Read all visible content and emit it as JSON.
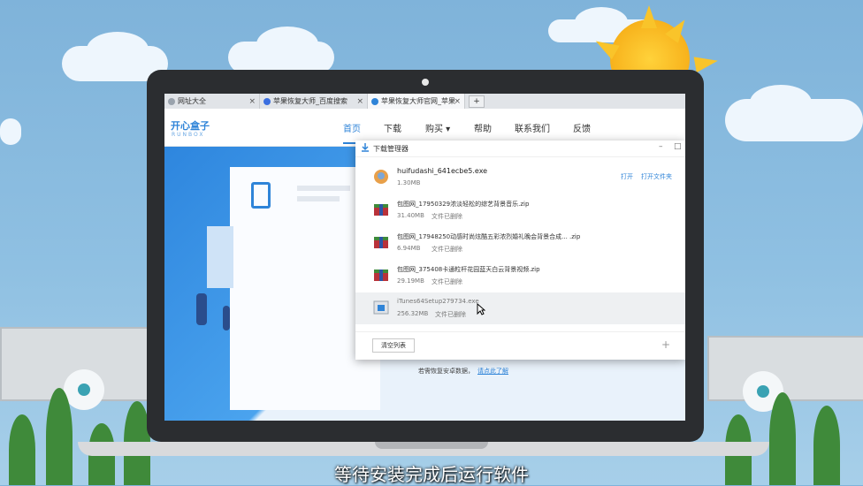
{
  "browser": {
    "tabs": [
      {
        "label": "网址大全"
      },
      {
        "label": "苹果恢复大师_百度搜索"
      },
      {
        "label": "苹果恢复大师官网_苹果"
      }
    ],
    "new_tab_label": "+",
    "close_glyph": "×"
  },
  "site": {
    "logo": "开心盒子",
    "logo_sub": "RUNBOX",
    "nav": [
      {
        "label": "首页"
      },
      {
        "label": "下载"
      },
      {
        "label": "购买 ▾"
      },
      {
        "label": "帮助"
      },
      {
        "label": "联系我们"
      },
      {
        "label": "反馈"
      }
    ],
    "footer_line1": "若需恢复安卓数据，",
    "footer_link": "请点此了解"
  },
  "download_manager": {
    "title": "下载管理器",
    "minimize": "–",
    "maximize": "□",
    "items": [
      {
        "name": "huifudashi_641ecbe5.exe",
        "size": "1.30MB",
        "status": "",
        "actions": [
          "打开",
          "打开文件夹"
        ],
        "icon": "app-icon"
      },
      {
        "name": "包图网_17950329浓淡轻松的综艺背景音乐.zip",
        "size": "31.40MB",
        "status": "文件已删除",
        "actions": [],
        "icon": "archive-icon"
      },
      {
        "name": "包图网_17948250动感时尚炫酷五彩浓烈婚礼晚会背景合成... .zip",
        "size": "6.94MB",
        "status": "文件已删除",
        "actions": [],
        "icon": "archive-icon"
      },
      {
        "name": "包图网_375408卡通粒杆花园蓝天白云背景视频.zip",
        "size": "29.19MB",
        "status": "文件已删除",
        "actions": [],
        "icon": "archive-icon"
      },
      {
        "name": "iTunes64Setup279734.exe",
        "size": "256.32MB",
        "status": "文件已删除",
        "actions": [],
        "icon": "installer-icon"
      }
    ],
    "clear_button": "清空列表",
    "add_glyph": "+"
  },
  "subtitle": "等待安装完成后运行软件",
  "colors": {
    "accent": "#2f84d8",
    "sky": "#8fc0e2"
  }
}
